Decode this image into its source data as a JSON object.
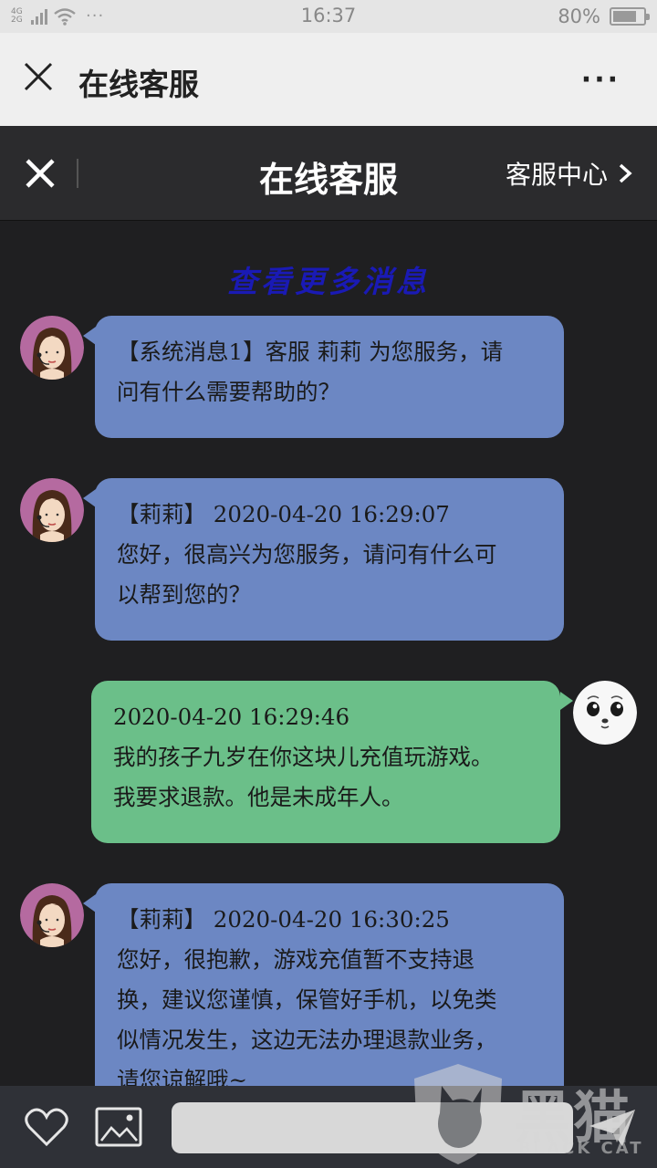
{
  "status_bar": {
    "network_top": "4G",
    "network_bottom": "2G",
    "time": "16:37",
    "battery": "80%",
    "battery_level": 0.8
  },
  "browser_header": {
    "title": "在线客服",
    "more": "···"
  },
  "app_header": {
    "title": "在线客服",
    "link": "客服中心"
  },
  "load_more": "查看更多消息",
  "messages": [
    {
      "sender": "agent",
      "lines": [
        "【系统消息1】客服 莉莉 为您服务，请",
        "问有什么需要帮助的？"
      ]
    },
    {
      "sender": "agent",
      "lines": [
        "【莉莉】 2020-04-20 16:29:07",
        "您好，很高兴为您服务，请问有什么可",
        "以帮到您的？"
      ]
    },
    {
      "sender": "user",
      "lines": [
        "2020-04-20 16:29:46",
        "我的孩子九岁在你这块儿充值玩游戏。",
        "我要求退款。他是未成年人。"
      ]
    },
    {
      "sender": "agent",
      "lines": [
        "【莉莉】 2020-04-20 16:30:25",
        "您好，很抱歉，游戏充值暂不支持退",
        "换，建议您谨慎，保管好手机，以免类",
        "似情况发生，这边无法办理退款业务，",
        "请您谅解哦~"
      ]
    }
  ],
  "bottom_bar": {
    "input_placeholder": ""
  },
  "watermark": {
    "text": "黑猫",
    "sub": "BLACK CAT"
  },
  "colors": {
    "agent_bubble": "#6c87c3",
    "user_bubble": "#6bbf89",
    "background": "#1f1f21",
    "load_more": "#1a1ab5"
  }
}
